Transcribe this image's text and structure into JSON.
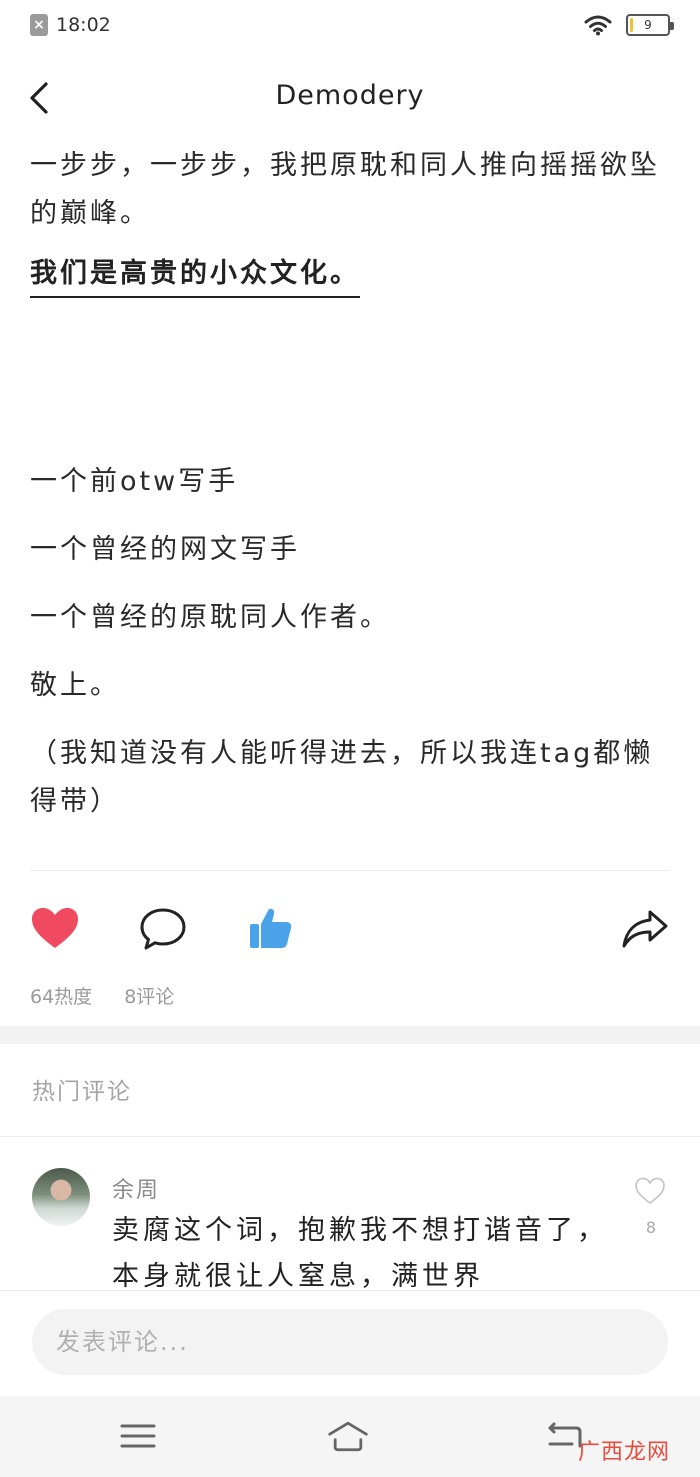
{
  "status_bar": {
    "time": "18:02",
    "sim_icon": "x-box-icon",
    "wifi_icon": "wifi-icon",
    "battery_level_text": "9",
    "battery_level": 0.09
  },
  "header": {
    "back_icon": "chevron-left-icon",
    "title": "Demodery"
  },
  "article": {
    "paragraph1": "一步步，一步步，我把原耽和同人推向摇摇欲坠的巅峰。",
    "bold_line": "我们是高贵的小众文化。",
    "lines": [
      "一个前otw写手",
      "一个曾经的网文写手",
      "一个曾经的原耽同人作者。",
      "敬上。",
      "（我知道没有人能听得进去，所以我连tag都懒得带）"
    ]
  },
  "actions": {
    "heat_count": "64热度",
    "comment_count": "8评论",
    "colors": {
      "heart": "#ef4a5f",
      "thumb": "#4aa3e8"
    }
  },
  "hot_comments": {
    "title": "热门评论",
    "items": [
      {
        "author": "余周",
        "text": "卖腐这个词，抱歉我不想打谐音了，本身就很让人窒息，满世界",
        "likes": "8"
      }
    ]
  },
  "comment_input": {
    "placeholder": "发表评论..."
  },
  "watermark": "广西龙网"
}
